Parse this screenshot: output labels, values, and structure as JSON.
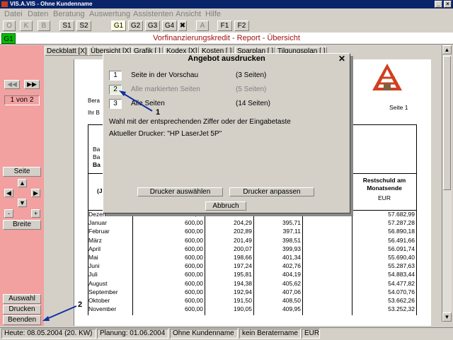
{
  "window": {
    "title": "VIS.A.VIS - Ohne Kundenname"
  },
  "menu": [
    "Datei",
    "Daten",
    "Beratung",
    "Auswertung",
    "Assistenten",
    "Ansicht",
    "Hilfe"
  ],
  "toolbar": {
    "left": [
      "O",
      "K",
      "B"
    ],
    "s": [
      "S1",
      "S2"
    ],
    "g": [
      "G1",
      "G2",
      "G3",
      "G4"
    ],
    "x": "✖",
    "a": "A",
    "f": [
      "F1",
      "F2"
    ]
  },
  "header": {
    "badge": "G1",
    "title": "Vorfinanzierungskredit - Report - Übersicht"
  },
  "tabs": [
    "Deckblatt [X]",
    "Übersicht [X]",
    "Grafik [ ]",
    "Kodex [X]",
    "Kosten [ ]",
    "Sparplan [ ]",
    "Tilgungsplan [ ]"
  ],
  "sidebar": {
    "page_of": "1 von 2",
    "seite": "Seite",
    "minus": "-",
    "plus": "+",
    "breite": "Breite",
    "auswahl": "Auswahl",
    "drucken": "Drucken",
    "beenden": "Beenden"
  },
  "report": {
    "bera": "Bera",
    "ihr_b": "Ihr B",
    "seite": "Seite  1",
    "ba1": "Ba",
    "ba2": "Ba",
    "ba3": "Ba",
    "j_label": "(J",
    "restschuld_header": "Restschuld am Monatsende",
    "restschuld_unit": "EUR",
    "rows": [
      {
        "month": "Dezember",
        "rate": "600,00",
        "zins": "",
        "tilg": "",
        "rest": "57.682,99"
      },
      {
        "month": "Januar",
        "rate": "600,00",
        "zins": "204,29",
        "tilg": "395,71",
        "rest": "57.287,28"
      },
      {
        "month": "Februar",
        "rate": "600,00",
        "zins": "202,89",
        "tilg": "397,11",
        "rest": "56.890,18"
      },
      {
        "month": "März",
        "rate": "600,00",
        "zins": "201,49",
        "tilg": "398,51",
        "rest": "56.491,66"
      },
      {
        "month": "April",
        "rate": "600,00",
        "zins": "200,07",
        "tilg": "399,93",
        "rest": "56.091,74"
      },
      {
        "month": "Mai",
        "rate": "600,00",
        "zins": "198,66",
        "tilg": "401,34",
        "rest": "55.690,40"
      },
      {
        "month": "Juni",
        "rate": "600,00",
        "zins": "197,24",
        "tilg": "402,76",
        "rest": "55.287,63"
      },
      {
        "month": "Juli",
        "rate": "600,00",
        "zins": "195,81",
        "tilg": "404,19",
        "rest": "54.883,44"
      },
      {
        "month": "August",
        "rate": "600,00",
        "zins": "194,38",
        "tilg": "405,62",
        "rest": "54.477,82"
      },
      {
        "month": "September",
        "rate": "600,00",
        "zins": "192,94",
        "tilg": "407,06",
        "rest": "54.070,76"
      },
      {
        "month": "Oktober",
        "rate": "600,00",
        "zins": "191,50",
        "tilg": "408,50",
        "rest": "53.662,26"
      },
      {
        "month": "November",
        "rate": "600,00",
        "zins": "190,05",
        "tilg": "409,95",
        "rest": "53.252,32"
      }
    ]
  },
  "modal": {
    "title": "Angebot ausdrucken",
    "close": "✕",
    "options": [
      {
        "num": "1",
        "label": "Seite in der Vorschau",
        "count": "(3 Seiten)"
      },
      {
        "num": "2",
        "label": "Alle markierten Seiten",
        "count": "(5 Seiten)"
      },
      {
        "num": "3",
        "label": "Alle Seiten",
        "count": "(14 Seiten)"
      }
    ],
    "hint": "Wahl mit der entsprechenden Ziffer oder der Eingabetaste",
    "printer": "Aktueller Drucker: \"HP LaserJet 5P\"",
    "btn_select": "Drucker auswählen",
    "btn_adjust": "Drucker anpassen",
    "btn_cancel": "Abbruch"
  },
  "annotations": {
    "a1": "1",
    "a2": "2"
  },
  "status": [
    "Heute: 08.05.2004 (20. KW)",
    "Planung: 01.06.2004",
    "Ohne Kundenname",
    "kein Beratername",
    "EUR"
  ]
}
